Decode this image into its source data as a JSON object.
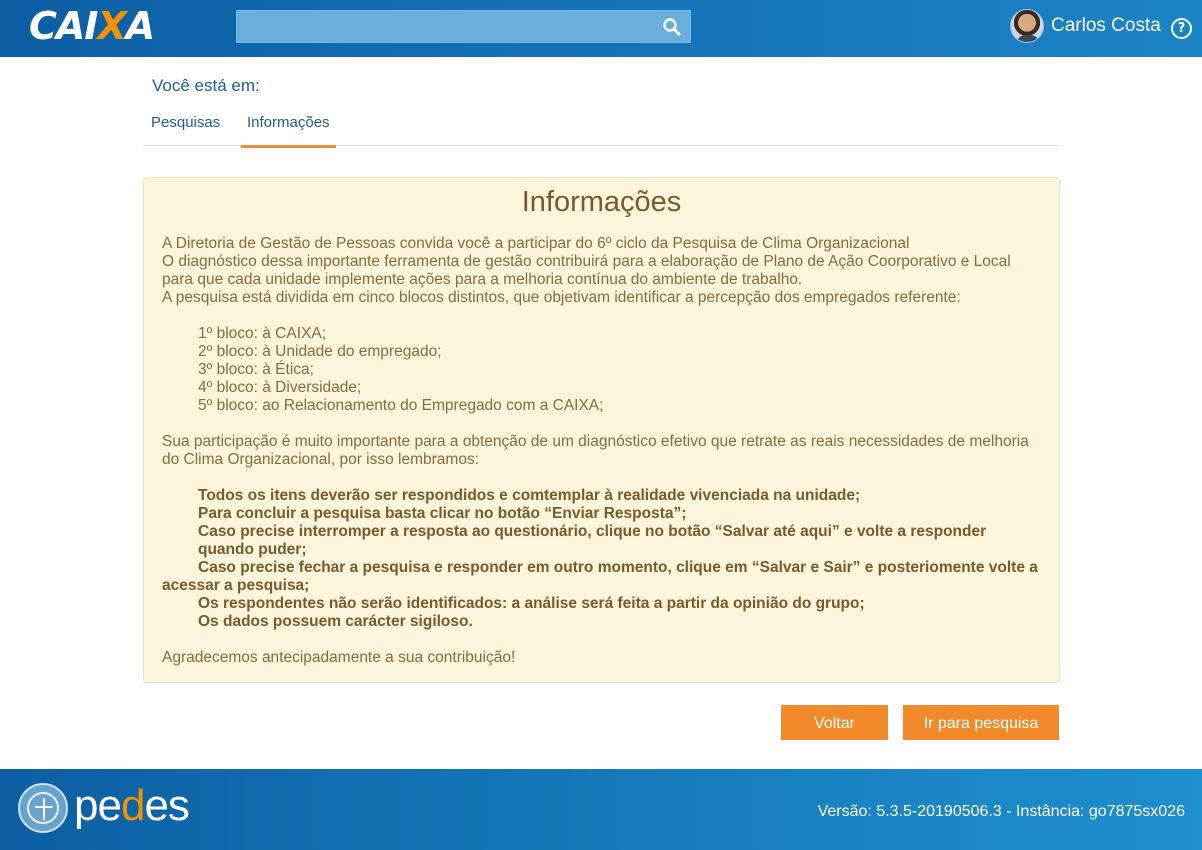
{
  "header": {
    "logo_text_left": "CAI",
    "logo_text_x": "X",
    "logo_text_right": "A",
    "search": {
      "value": "",
      "placeholder": "",
      "icon": "search-icon"
    },
    "user": {
      "name": "Carlos Costa",
      "avatar_icon": "user-avatar"
    },
    "help_label": "?"
  },
  "breadcrumb": {
    "label": "Você está em:",
    "tabs": [
      {
        "label": "Pesquisas",
        "active": false
      },
      {
        "label": "Informações",
        "active": true
      }
    ]
  },
  "info": {
    "title": "Informações",
    "intro": [
      "A Diretoria de Gestão de Pessoas convida você a participar do 6º ciclo da Pesquisa de Clima Organizacional",
      "O diagnóstico dessa importante ferramenta de gestão contribuirá para a elaboração de Plano de Ação Coorporativo e Local para que cada unidade implemente ações para a melhoria contínua do ambiente de trabalho.",
      "A pesquisa está dividida em cinco blocos distintos, que objetivam identificar a percepção dos empregados referente:"
    ],
    "blocks": [
      "1º bloco: à CAIXA;",
      "2º bloco: à Unidade do empregado;",
      "3º bloco: à Ética;",
      "4º bloco: à Diversidade;",
      "5º bloco: ao Relacionamento do Empregado com a CAIXA;"
    ],
    "participation": "Sua participação é muito importante para a obtenção de um diagnóstico efetivo que retrate as reais necessidades  de melhoria do Clima Organizacional, por isso lembramos:",
    "reminders": [
      "Todos os itens deverão ser respondidos e comtemplar à realidade vivenciada na unidade;",
      "Para concluir a pesquisa basta clicar no botão “Enviar Resposta”;",
      "Caso precise interromper a resposta ao questionário, clique no botão “Salvar até aqui” e volte a responder quando puder;",
      "Caso precise fechar a pesquisa e responder em outro momento, clique em “Salvar e Sair” e posteriomente volte a acessar a pesquisa;",
      "Os respondentes não serão identificados: a análise será feita a partir da opinião do grupo;",
      "Os dados possuem carácter sigiloso."
    ],
    "thanks": "Agradecemos antecipadamente a sua contribuição!"
  },
  "buttons": {
    "back_label": "Voltar",
    "go_label": "Ir para pesquisa"
  },
  "footer": {
    "brand_left": "pe",
    "brand_d": "d",
    "brand_right": "es",
    "version": "Versão: 5.3.5-20190506.3 - Instância: go7875sx026"
  },
  "colors": {
    "header_blue": "#0c5ea3",
    "accent_orange": "#f28a2c",
    "info_bg": "#fdf5dc",
    "text_brown": "#8a6a3c",
    "link_blue": "#1d5e91"
  }
}
